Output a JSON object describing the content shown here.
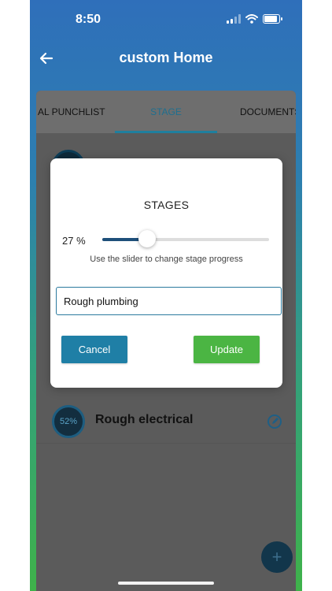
{
  "status_bar": {
    "time": "8:50"
  },
  "header": {
    "title": "custom Home"
  },
  "tabs": [
    {
      "label": "AL PUNCHLIST"
    },
    {
      "label": "STAGE",
      "active": true
    },
    {
      "label": "DOCUMENTS"
    }
  ],
  "stages": [
    {
      "label": "Rough electrical",
      "progress_text": "52%",
      "progress": 52
    }
  ],
  "modal": {
    "title": "STAGES",
    "progress": 27,
    "progress_text": "27 %",
    "hint": "Use the slider to change stage progress",
    "input_value": "Rough plumbing",
    "cancel_label": "Cancel",
    "update_label": "Update"
  },
  "fab": {
    "symbol": "+"
  },
  "colors": {
    "gradient_top": "#2f6fba",
    "gradient_bottom": "#3fb24a",
    "cancel_button": "#1f7fa6",
    "update_button": "#4bb543",
    "active_tab": "#1e6f8f",
    "slider_fill": "#1e4f7a"
  },
  "icons": [
    "back-arrow-icon",
    "signal-icon",
    "wifi-icon",
    "battery-icon",
    "edit-icon",
    "plus-icon"
  ]
}
